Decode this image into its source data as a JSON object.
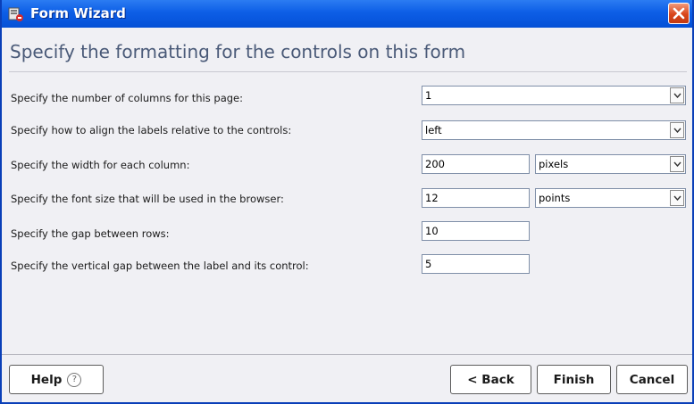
{
  "window": {
    "title": "Form Wizard"
  },
  "heading": "Specify the formatting for the controls on this form",
  "fields": {
    "columns": {
      "label": "Specify the number of columns for this page:",
      "value": "1"
    },
    "align": {
      "label": "Specify how to align the labels relative to the controls:",
      "value": "left"
    },
    "width": {
      "label": "Specify the width for each column:",
      "value": "200",
      "unit": "pixels"
    },
    "font_size": {
      "label": "Specify the font size that will be used in the browser:",
      "value": "12",
      "unit": "points"
    },
    "row_gap": {
      "label": "Specify the gap between rows:",
      "value": "10"
    },
    "label_gap": {
      "label": "Specify the vertical gap between the label and its control:",
      "value": "5"
    }
  },
  "buttons": {
    "help": "Help",
    "help_icon": "?",
    "back": "< Back",
    "finish": "Finish",
    "cancel": "Cancel"
  },
  "colors": {
    "title_bar": "#0d5ee6",
    "heading_text": "#4a5a78",
    "close_button": "#d9461b"
  },
  "icons": [
    "app-icon",
    "close-icon",
    "chevron-down-icon",
    "help-icon"
  ]
}
